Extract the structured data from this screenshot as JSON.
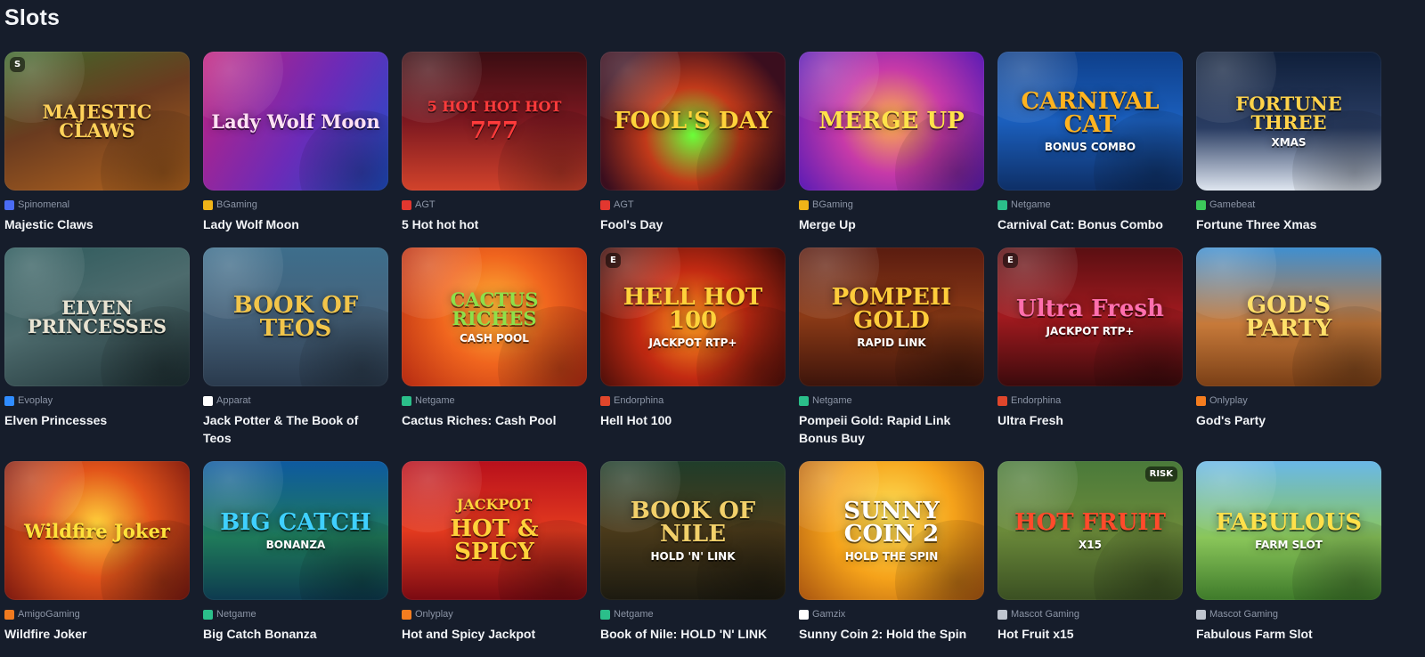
{
  "section_title": "Slots",
  "games": [
    {
      "name": "Majestic Claws",
      "provider": "Spinomenal",
      "provider_icon": "spinomenal-s-icon",
      "provider_color": "#4b6cf5",
      "art_text": "MAJESTIC CLAWS",
      "art_bg": "linear-gradient(160deg,#3f6a2c 0%,#6a3b1f 45%,#b5661f 100%)",
      "art_color": "#ffd25a",
      "badge": "S"
    },
    {
      "name": "Lady Wolf Moon",
      "provider": "BGaming",
      "provider_icon": "bgaming-bg-icon",
      "provider_color": "#f0b418",
      "art_text": "Lady Wolf Moon",
      "art_bg": "linear-gradient(120deg,#c2227e 0%,#6b2bb8 55%,#1f4ec7 100%)",
      "art_color": "#ffe1f3"
    },
    {
      "name": "5 Hot hot hot",
      "provider": "AGT",
      "provider_icon": "agt-triangle-icon",
      "provider_color": "#e2372f",
      "art_text": "777",
      "art_bg": "linear-gradient(180deg,#3a0d12 0%,#7c1820 50%,#d2432b 100%)",
      "art_color": "#ff3b3b",
      "top_text": "5 HOT HOT HOT"
    },
    {
      "name": "Fool's Day",
      "provider": "AGT",
      "provider_icon": "agt-triangle-icon",
      "provider_color": "#e2372f",
      "art_text": "FOOL'S DAY",
      "art_bg": "radial-gradient(circle at 50% 60%,#6bff3a 0%,#c13a1a 38%,#3a0e1e 80%)",
      "art_color": "#ffd23b"
    },
    {
      "name": "Merge Up",
      "provider": "BGaming",
      "provider_icon": "bgaming-bg-icon",
      "provider_color": "#f0b418",
      "art_text": "MERGE UP",
      "art_bg": "radial-gradient(circle at 50% 50%,#ffb347 0%,#c73aa8 45%,#5a1bb5 100%)",
      "art_color": "#ffe24a"
    },
    {
      "name": "Carnival Cat: Bonus Combo",
      "provider": "Netgame",
      "provider_icon": "netgame-diamond-icon",
      "provider_color": "#2bbf8a",
      "art_text": "CARNIVAL CAT",
      "art_sub": "BONUS COMBO",
      "art_bg": "linear-gradient(180deg,#0e3f8a 0%,#1b5fbd 50%,#0e2f66 100%)",
      "art_color": "#ffb31f"
    },
    {
      "name": "Fortune Three Xmas",
      "provider": "Gamebeat",
      "provider_icon": "gamebeat-slash-icon",
      "provider_color": "#3cc85a",
      "art_text": "FORTUNE THREE",
      "art_sub": "XMAS",
      "art_bg": "linear-gradient(180deg,#0f1f3a 0%,#2a3d63 55%,#dfe6f0 100%)",
      "art_color": "#ffd34a"
    },
    {
      "name": "Elven Princesses",
      "provider": "Evoplay",
      "provider_icon": "evoplay-stripes-icon",
      "provider_color": "#2f8cff",
      "art_text": "ELVEN PRINCESSES",
      "art_bg": "linear-gradient(160deg,#2c5a5c 0%,#4d6b6d 45%,#1d2f33 100%)",
      "art_color": "#e9e3d2"
    },
    {
      "name": "Jack Potter & The Book of Teos",
      "provider": "Apparat",
      "provider_icon": "apparat-a-icon",
      "provider_color": "#ffffff",
      "art_text": "BOOK OF TEOS",
      "art_bg": "linear-gradient(180deg,#3d6e8c 0%,#46627a 50%,#2a3a4d 100%)",
      "art_color": "#f2c54a"
    },
    {
      "name": "Cactus Riches: Cash Pool",
      "provider": "Netgame",
      "provider_icon": "netgame-diamond-icon",
      "provider_color": "#2bbf8a",
      "art_text": "CACTUS RICHES",
      "art_sub": "CASH POOL",
      "art_bg": "radial-gradient(circle at 50% 45%,#ffb637 0%,#f0651e 45%,#b52a12 100%)",
      "art_color": "#8ee04a"
    },
    {
      "name": "Hell Hot 100",
      "provider": "Endorphina",
      "provider_icon": "endorphina-e-icon",
      "provider_color": "#e0462b",
      "art_text": "HELL HOT 100",
      "art_sub": "JACKPOT RTP+",
      "art_bg": "radial-gradient(circle at 50% 55%,#ff9a1f 0%,#c22a12 45%,#3a0a08 100%)",
      "art_color": "#ffd23b",
      "badge": "E"
    },
    {
      "name": "Pompeii Gold: Rapid Link Bonus Buy",
      "provider": "Netgame",
      "provider_icon": "netgame-diamond-icon",
      "provider_color": "#2bbf8a",
      "art_text": "POMPEII GOLD",
      "art_sub": "RAPID LINK",
      "art_bg": "linear-gradient(180deg,#5a1c10 0%,#8b3a16 50%,#3c140b 100%)",
      "art_color": "#ffcc3b"
    },
    {
      "name": "Ultra Fresh",
      "provider": "Endorphina",
      "provider_icon": "endorphina-e-icon",
      "provider_color": "#e0462b",
      "art_text": "Ultra Fresh",
      "art_sub": "JACKPOT RTP+",
      "art_bg": "linear-gradient(180deg,#5a0f12 0%,#a11a1f 50%,#3a0a0c 100%)",
      "art_color": "#ff6fae",
      "badge": "E"
    },
    {
      "name": "God's Party",
      "provider": "Onlyplay",
      "provider_icon": "onlyplay-circle-icon",
      "provider_color": "#f57d1f",
      "art_text": "GOD'S PARTY",
      "art_bg": "linear-gradient(180deg,#3f8fd0 0%,#c77a3a 55%,#7a3f16 100%)",
      "art_color": "#ffe06a"
    },
    {
      "name": "Wildfire Joker",
      "provider": "AmigoGaming",
      "provider_icon": "amigo-hat-icon",
      "provider_color": "#f07a1f",
      "art_text": "Wildfire Joker",
      "art_bg": "radial-gradient(circle at 50% 45%,#ffcf3a 0%,#e2541a 45%,#7a1810 100%)",
      "art_color": "#ffe23b"
    },
    {
      "name": "Big Catch Bonanza",
      "provider": "Netgame",
      "provider_icon": "netgame-diamond-icon",
      "provider_color": "#2bbf8a",
      "art_text": "BIG CATCH",
      "art_sub": "BONANZA",
      "art_bg": "linear-gradient(180deg,#0e5aa0 0%,#1f7a5a 55%,#0d3a4f 100%)",
      "art_color": "#3fd0ff"
    },
    {
      "name": "Hot and Spicy Jackpot",
      "provider": "Onlyplay",
      "provider_icon": "onlyplay-circle-icon",
      "provider_color": "#f57d1f",
      "art_text": "HOT & SPICY",
      "top_text": "JACKPOT",
      "art_bg": "linear-gradient(180deg,#b8101c 0%,#e33a1f 50%,#7a0a12 100%)",
      "art_color": "#ffd23b"
    },
    {
      "name": "Book of Nile: HOLD 'N' LINK",
      "provider": "Netgame",
      "provider_icon": "netgame-diamond-icon",
      "provider_color": "#2bbf8a",
      "art_text": "BOOK OF NILE",
      "art_sub": "HOLD 'N' LINK",
      "art_bg": "linear-gradient(180deg,#1f3d2a 0%,#4a3a1a 50%,#1c1a10 100%)",
      "art_color": "#f2d06a"
    },
    {
      "name": "Sunny Coin 2: Hold the Spin",
      "provider": "Gamzix",
      "provider_icon": "gamzix-g-icon",
      "provider_color": "#ffffff",
      "art_text": "SUNNY COIN 2",
      "art_sub": "HOLD THE SPIN",
      "art_bg": "radial-gradient(circle at 50% 40%,#ffe35a 0%,#f5a21a 50%,#a85410 100%)",
      "art_color": "#ffffff"
    },
    {
      "name": "Hot Fruit x15",
      "provider": "Mascot Gaming",
      "provider_icon": "mascot-square-icon",
      "provider_color": "#bfc5cf",
      "art_text": "HOT FRUIT",
      "art_sub": "X15",
      "art_bg": "linear-gradient(180deg,#4a7a3a 0%,#6b8a3a 50%,#3a4f22 100%)",
      "art_color": "#ff4b2b",
      "badge_right": "RISK"
    },
    {
      "name": "Fabulous Farm Slot",
      "provider": "Mascot Gaming",
      "provider_icon": "mascot-square-icon",
      "provider_color": "#bfc5cf",
      "art_text": "FABULOUS",
      "art_sub": "FARM SLOT",
      "art_bg": "linear-gradient(180deg,#6ab8e8 0%,#8ac65a 55%,#3e7a2a 100%)",
      "art_color": "#ffe04a"
    }
  ]
}
